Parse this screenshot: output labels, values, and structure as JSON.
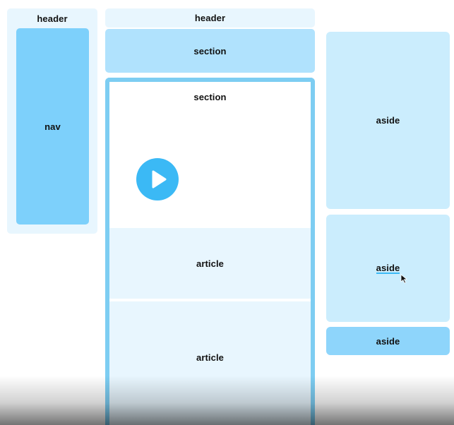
{
  "left_column": {
    "header_label": "header",
    "nav_label": "nav"
  },
  "middle_column": {
    "header_label": "header",
    "section_top_label": "section",
    "section_main_label": "section",
    "article_1_label": "article",
    "article_2_label": "article"
  },
  "right_column": {
    "aside_1_label": "aside",
    "aside_2_label": "aside",
    "aside_3_label": "aside"
  },
  "video": {
    "play_icon": "play-icon",
    "accent_color": "#3bb9f5"
  },
  "colors": {
    "pale_blue": "#e8f6fe",
    "light_blue": "#cbedfd",
    "medium_blue": "#b0e2fd",
    "nav_blue": "#7dd0fb",
    "frame_blue": "#7dcdf2"
  }
}
